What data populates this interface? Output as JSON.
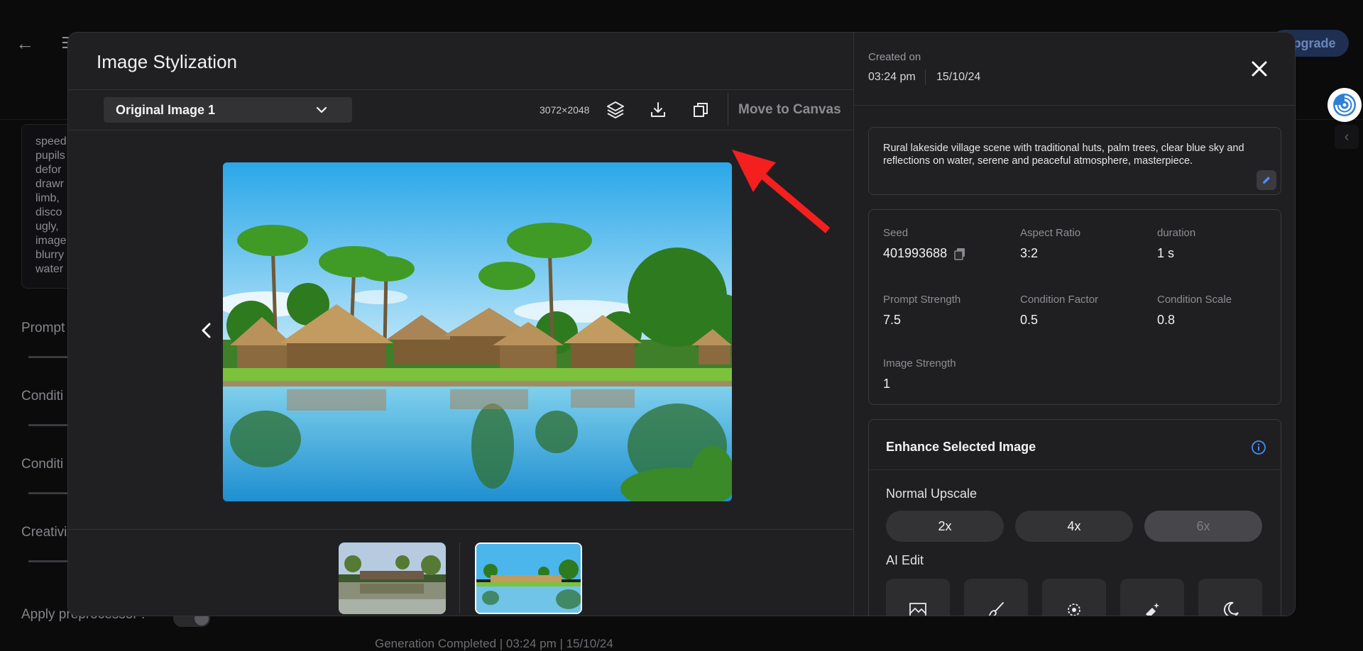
{
  "background": {
    "upgrade_label": "Upgrade",
    "negative_prompt_lines": [
      "speed",
      "pupils",
      "defor",
      "drawr",
      "limb,",
      "disco",
      "ugly,",
      "image",
      "blurry",
      "water"
    ],
    "settings": [
      "Prompt",
      "Conditi",
      "Conditi",
      "Creativi"
    ],
    "apply_preprocessor": "Apply preprocessor :",
    "bottom_status": "Generation Completed  |  03:24 pm  |  15/10/24"
  },
  "modal": {
    "title": "Image Stylization",
    "image_select": {
      "value": "Original Image 1"
    },
    "resolution": "3072×2048",
    "toolbar_icons": [
      "layers-icon",
      "download-icon",
      "copy-icon"
    ],
    "move_to_canvas": "Move to Canvas",
    "thumbnails": [
      "original-image-1",
      "stylized-image"
    ]
  },
  "details": {
    "created_label": "Created on",
    "created_time": "03:24 pm",
    "created_date": "15/10/24",
    "prompt": "Rural lakeside village scene with traditional huts, palm trees, clear blue sky and reflections on water, serene and peaceful atmosphere, masterpiece.",
    "params": [
      {
        "label": "Seed",
        "value": "401993688",
        "copyable": true
      },
      {
        "label": "Aspect Ratio",
        "value": "3:2"
      },
      {
        "label": "duration",
        "value": "1 s"
      },
      {
        "label": "Prompt Strength",
        "value": "7.5"
      },
      {
        "label": "Condition Factor",
        "value": "0.5"
      },
      {
        "label": "Condition Scale",
        "value": "0.8"
      },
      {
        "label": "Image Strength",
        "value": "1"
      }
    ]
  },
  "enhance": {
    "title": "Enhance Selected Image",
    "normal_upscale_label": "Normal Upscale",
    "upscale_options": [
      {
        "label": "2x",
        "enabled": true
      },
      {
        "label": "4x",
        "enabled": true
      },
      {
        "label": "6x",
        "enabled": false
      }
    ],
    "ai_edit_label": "AI Edit",
    "ai_edit_tools": [
      "image-edit-icon",
      "brush-icon",
      "remove-background-icon",
      "magic-eraser-icon",
      "night-mode-icon"
    ]
  },
  "colors": {
    "accent": "#3b82f6",
    "annotation_arrow": "#f41f1f",
    "modal_bg": "#202022"
  }
}
